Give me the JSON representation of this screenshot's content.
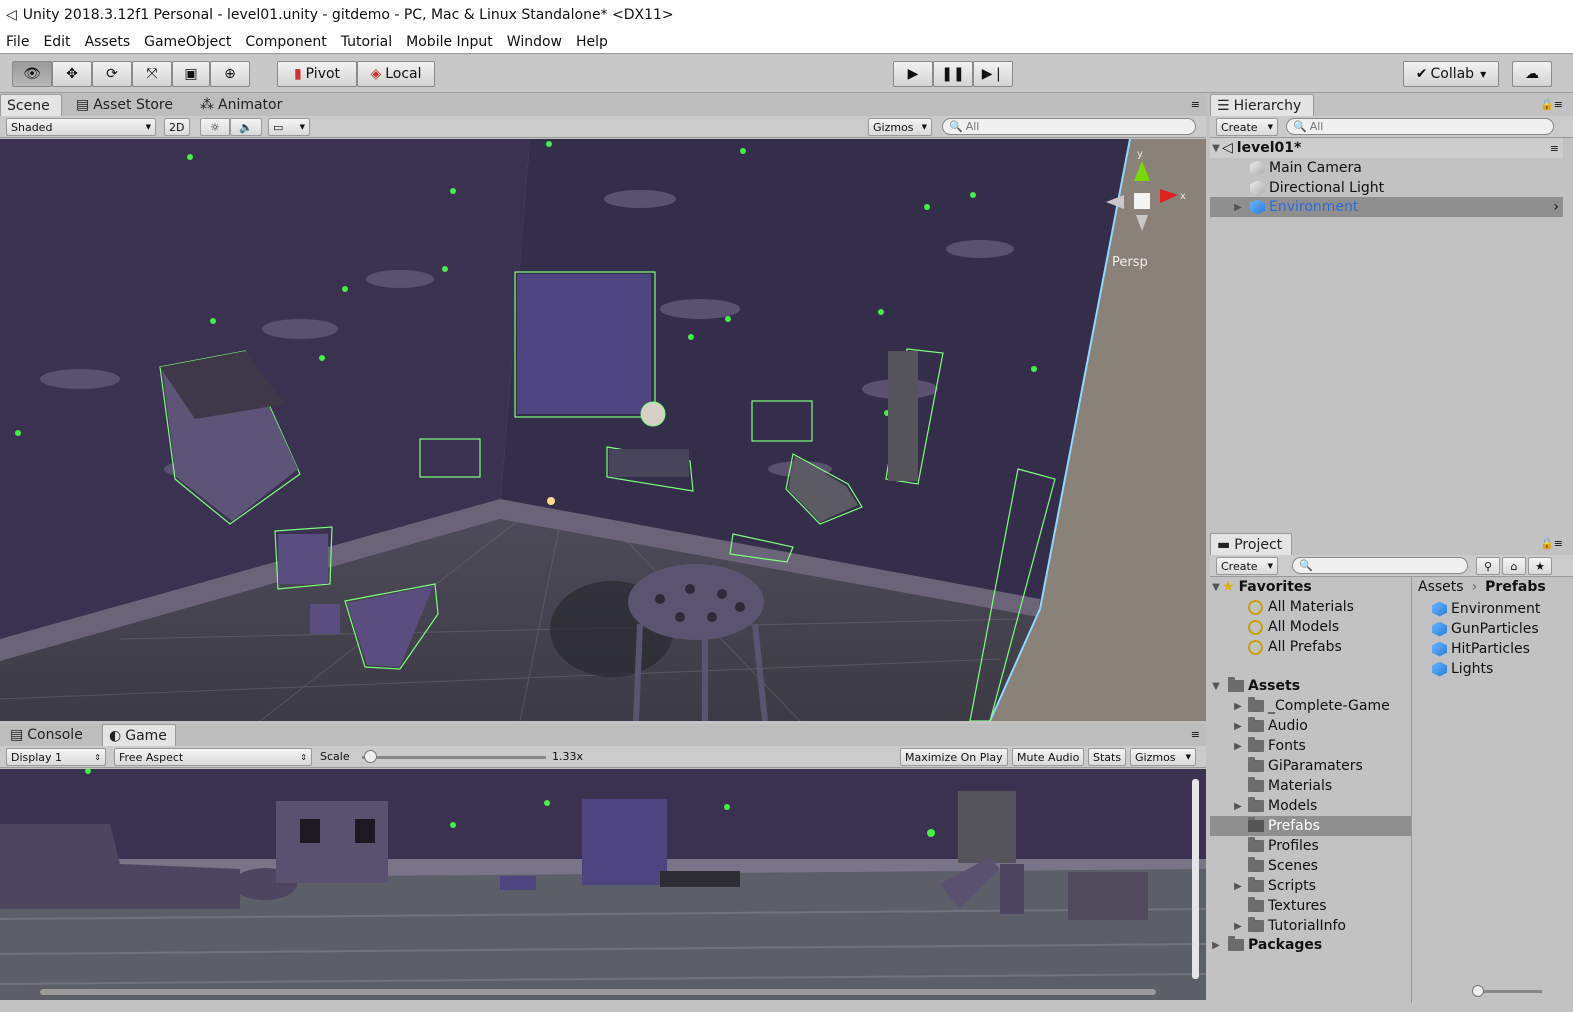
{
  "window": {
    "title": "Unity 2018.3.12f1 Personal - level01.unity - gitdemo - PC, Mac & Linux Standalone* <DX11>"
  },
  "menu": [
    "File",
    "Edit",
    "Assets",
    "GameObject",
    "Component",
    "Tutorial",
    "Mobile Input",
    "Window",
    "Help"
  ],
  "toolbar": {
    "pivot": "Pivot",
    "local": "Local",
    "collab": "Collab"
  },
  "scene_tabs": {
    "scene": "Scene",
    "asset_store": "Asset Store",
    "animator": "Animator"
  },
  "scene_bar": {
    "shading": "Shaded",
    "mode_2d": "2D",
    "gizmos": "Gizmos",
    "search_placeholder": "All"
  },
  "scene_view": {
    "projection": "Persp",
    "axis_y": "y",
    "axis_x": "x"
  },
  "game_tabs": {
    "console": "Console",
    "game": "Game"
  },
  "game_bar": {
    "display": "Display 1",
    "aspect": "Free Aspect",
    "scale_label": "Scale",
    "scale_value": "1.33x",
    "maximize": "Maximize On Play",
    "mute": "Mute Audio",
    "stats": "Stats",
    "gizmos": "Gizmos"
  },
  "hierarchy": {
    "tab": "Hierarchy",
    "create": "Create",
    "search_placeholder": "All",
    "scene": "level01*",
    "items": [
      "Main Camera",
      "Directional Light",
      "Environment"
    ]
  },
  "project": {
    "tab": "Project",
    "create": "Create",
    "favorites_label": "Favorites",
    "favorites": [
      "All Materials",
      "All Models",
      "All Prefabs"
    ],
    "assets_label": "Assets",
    "folders": [
      "_Complete-Game",
      "Audio",
      "Fonts",
      "GiParamaters",
      "Materials",
      "Models",
      "Prefabs",
      "Profiles",
      "Scenes",
      "Scripts",
      "Textures",
      "TutorialInfo"
    ],
    "packages_label": "Packages",
    "breadcrumb": [
      "Assets",
      "Prefabs"
    ],
    "prefabs": [
      "Environment",
      "GunParticles",
      "HitParticles",
      "Lights"
    ]
  },
  "colors": {
    "selected_row": "#8f8f8f",
    "selected_text": "#2d6bd6",
    "star_green": "#42f046",
    "wall_purple": "#3a3250"
  }
}
